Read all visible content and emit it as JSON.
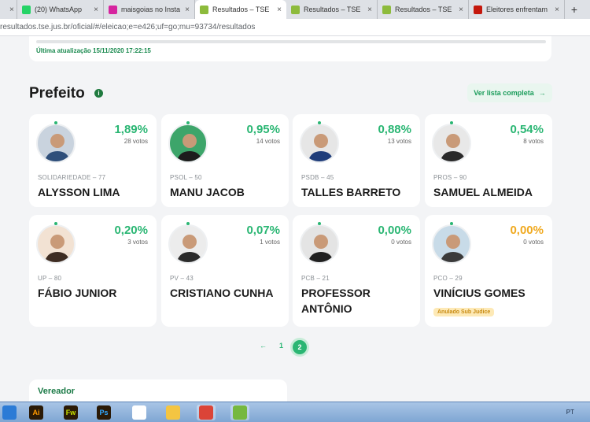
{
  "browser": {
    "tabs": [
      {
        "title": "",
        "favicon": "blank",
        "color": "#bfbfbf",
        "active": false
      },
      {
        "title": "(20) WhatsApp",
        "favicon": "whatsapp-icon",
        "color": "#25d366",
        "active": false
      },
      {
        "title": "maisgoias no Instag",
        "favicon": "instagram-icon",
        "color": "#d6249f",
        "active": false
      },
      {
        "title": "Resultados – TSE",
        "favicon": "tse-icon",
        "color": "#8dbb3c",
        "active": true
      },
      {
        "title": "Resultados – TSE",
        "favicon": "tse-icon",
        "color": "#8dbb3c",
        "active": false
      },
      {
        "title": "Resultados – TSE",
        "favicon": "tse-icon",
        "color": "#8dbb3c",
        "active": false
      },
      {
        "title": "Eleitores enfrentam",
        "favicon": "g1-icon",
        "color": "#c4170c",
        "active": false
      }
    ],
    "new_tab": "+",
    "url": "resultados.tse.jus.br/oficial/#/eleicao;e=e426;uf=go;mu=93734/resultados"
  },
  "update": {
    "label": "Última atualização 15/11/2020 17:22:15"
  },
  "section": {
    "title": "Prefeito",
    "info_icon": "i",
    "full_list_label": "Ver lista completa",
    "arrow": "→"
  },
  "candidates": [
    {
      "party": "SOLIDARIEDADE – 77",
      "name": "ALYSSON LIMA",
      "pct": "1,89%",
      "votes": "28 votos",
      "bg": "#c9d3de",
      "shirt": "#2f4f7a"
    },
    {
      "party": "PSOL – 50",
      "name": "MANU JACOB",
      "pct": "0,95%",
      "votes": "14 votos",
      "bg": "#3da56a",
      "shirt": "#1d1d1d"
    },
    {
      "party": "PSDB – 45",
      "name": "TALLES BARRETO",
      "pct": "0,88%",
      "votes": "13 votos",
      "bg": "#e6e6e6",
      "shirt": "#1f3d7a"
    },
    {
      "party": "PROS – 90",
      "name": "SAMUEL ALMEIDA",
      "pct": "0,54%",
      "votes": "8 votos",
      "bg": "#e8e8e8",
      "shirt": "#2a2a2a"
    },
    {
      "party": "UP – 80",
      "name": "FÁBIO JUNIOR",
      "pct": "0,20%",
      "votes": "3 votos",
      "bg": "#f2e2d3",
      "shirt": "#3d2c22"
    },
    {
      "party": "PV – 43",
      "name": "CRISTIANO CUNHA",
      "pct": "0,07%",
      "votes": "1 votos",
      "bg": "#ececec",
      "shirt": "#2b2b2b"
    },
    {
      "party": "PCB – 21",
      "name": "PROFESSOR ANTÔNIO",
      "pct": "0,00%",
      "votes": "0 votos",
      "bg": "#e4e4e4",
      "shirt": "#202020"
    },
    {
      "party": "PCO – 29",
      "name": "VINÍCIUS GOMES",
      "pct": "0,00%",
      "votes": "0 votos",
      "bg": "#c8dbe8",
      "shirt": "#3a3a3a",
      "badge": "Anulado Sub Judice",
      "pct_color": "orange"
    }
  ],
  "pagination": {
    "prev": "←",
    "page1": "1",
    "page2": "2"
  },
  "vereador": {
    "title": "Vereador"
  },
  "taskbar": {
    "apps": [
      {
        "label": "",
        "icon": "ie-icon",
        "color": "#2b7bd6"
      },
      {
        "label": "Ai",
        "icon": "illustrator-icon",
        "color": "#ff9a00"
      },
      {
        "label": "Fw",
        "icon": "fireworks-icon",
        "color": "#c7e000"
      },
      {
        "label": "Ps",
        "icon": "photoshop-icon",
        "color": "#31a8ff"
      },
      {
        "label": "",
        "icon": "magnifier-document-icon",
        "color": "#ffffff"
      },
      {
        "label": "",
        "icon": "folder-icon",
        "color": "#f4c542"
      },
      {
        "label": "",
        "icon": "chrome-icon",
        "color": "#db4437"
      },
      {
        "label": "",
        "icon": "utorrent-icon",
        "color": "#76b83f"
      }
    ],
    "language": "PT"
  }
}
